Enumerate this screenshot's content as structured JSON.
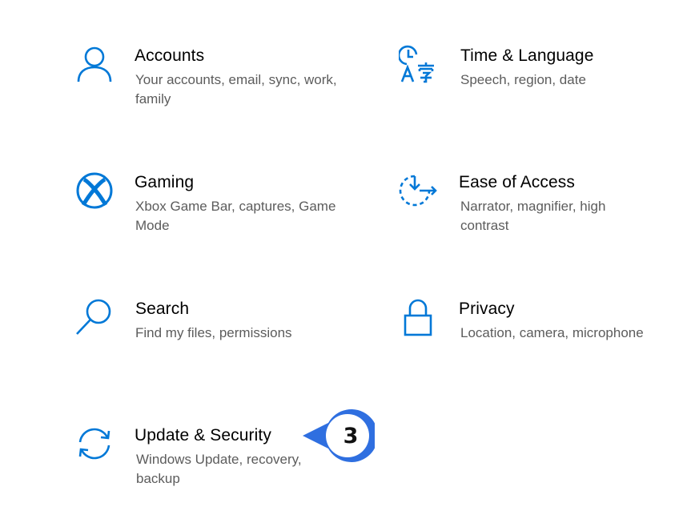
{
  "colors": {
    "accent": "#0078d7",
    "callout": "#2f6fe0"
  },
  "tiles": [
    {
      "icon": "person-icon",
      "title": "Accounts",
      "desc": "Your accounts, email, sync, work, family"
    },
    {
      "icon": "time-language-icon",
      "title": "Time & Language",
      "desc": "Speech, region, date"
    },
    {
      "icon": "xbox-icon",
      "title": "Gaming",
      "desc": "Xbox Game Bar, captures, Game Mode"
    },
    {
      "icon": "ease-of-access-icon",
      "title": "Ease of Access",
      "desc": "Narrator, magnifier, high contrast"
    },
    {
      "icon": "search-icon",
      "title": "Search",
      "desc": "Find my files, permissions"
    },
    {
      "icon": "lock-icon",
      "title": "Privacy",
      "desc": "Location, camera, microphone"
    },
    {
      "icon": "sync-icon",
      "title": "Update & Security",
      "desc": "Windows Update, recovery, backup"
    }
  ],
  "callout": {
    "number": "3"
  }
}
